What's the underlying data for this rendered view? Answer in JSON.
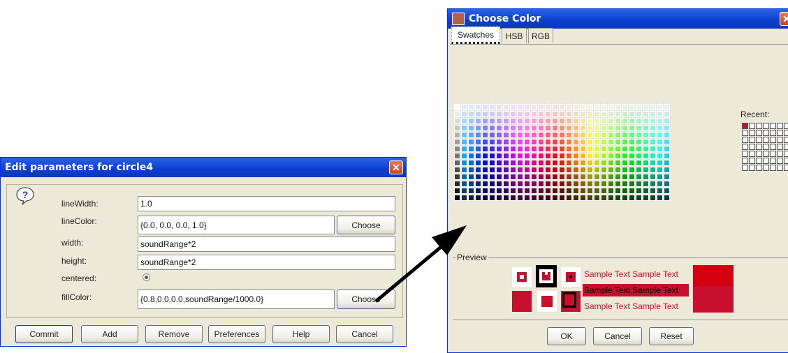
{
  "edit_dialog": {
    "title": "Edit parameters for circle4",
    "params": [
      {
        "label": "lineWidth:",
        "value": "1.0"
      },
      {
        "label": "lineColor:",
        "value": "{0.0, 0.0, 0.0, 1.0}"
      },
      {
        "label": "width:",
        "value": "soundRange*2"
      },
      {
        "label": "height:",
        "value": "soundRange*2"
      },
      {
        "label": "centered:",
        "value": ""
      },
      {
        "label": "fillColor:",
        "value": "{0.8,0.0,0.0,soundRange/1000.0}"
      }
    ],
    "choose_label": "Choose",
    "choose_label_2": "Choose",
    "buttons": [
      "Commit",
      "Add",
      "Remove",
      "Preferences",
      "Help",
      "Cancel"
    ],
    "close": "✕"
  },
  "color_dialog": {
    "title": "Choose Color",
    "tabs": [
      "Swatches",
      "HSB",
      "RGB"
    ],
    "recent_label": "Recent:",
    "preview_label": "Preview",
    "sample_text": "Sample Text",
    "buttons": [
      "OK",
      "Cancel",
      "Reset"
    ],
    "close": "✕",
    "selected_color": "#c8102e"
  }
}
